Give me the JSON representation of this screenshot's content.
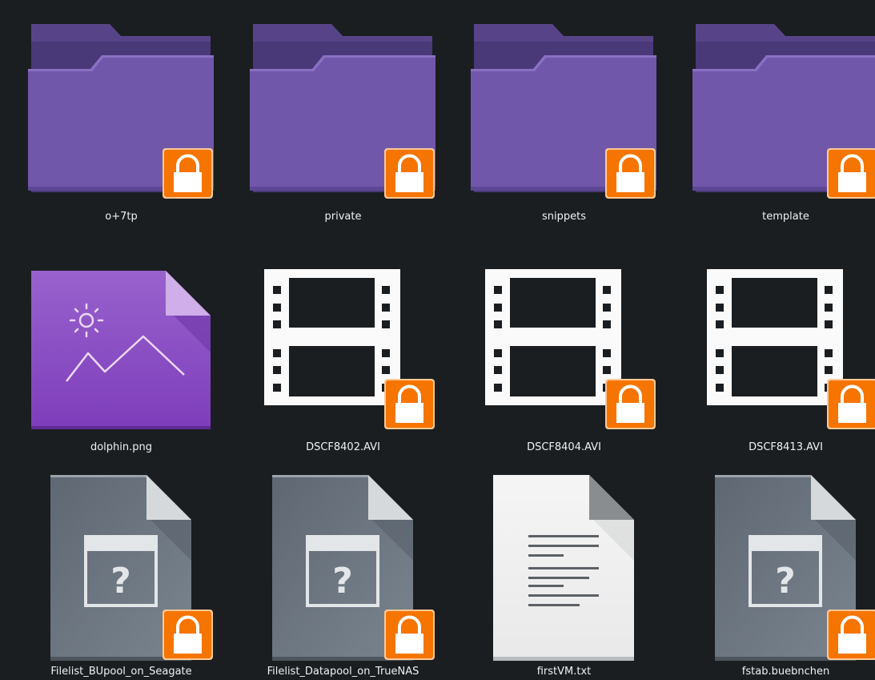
{
  "view": "icons",
  "files": [
    {
      "name": "o+7tp",
      "type": "folder",
      "locked": true
    },
    {
      "name": "private",
      "type": "folder",
      "locked": true
    },
    {
      "name": "snippets",
      "type": "folder",
      "locked": true
    },
    {
      "name": "template",
      "type": "folder",
      "locked": true
    },
    {
      "name": "dolphin.png",
      "type": "image",
      "locked": false
    },
    {
      "name": "DSCF8402.AVI",
      "type": "video",
      "locked": true
    },
    {
      "name": "DSCF8404.AVI",
      "type": "video",
      "locked": true
    },
    {
      "name": "DSCF8413.AVI",
      "type": "video",
      "locked": true
    },
    {
      "name": "Filelist_BUpool_on_Seagate",
      "type": "unknown",
      "locked": true
    },
    {
      "name": "Filelist_Datapool_on_TrueNAS",
      "type": "unknown",
      "locked": true
    },
    {
      "name": "firstVM.txt",
      "type": "text",
      "locked": false
    },
    {
      "name": "fstab.buebnchen",
      "type": "unknown",
      "locked": true
    }
  ],
  "colors": {
    "background": "#1b1e21",
    "folder_back": "#4b3a7a",
    "folder_front": "#7157a9",
    "lock_badge": "#f67400",
    "label_text": "#eff0f1"
  }
}
